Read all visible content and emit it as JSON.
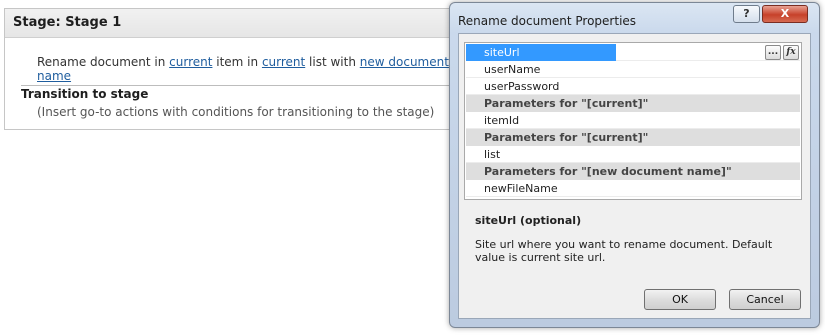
{
  "stage": {
    "title": "Stage: Stage 1",
    "action": {
      "prefix": "Rename document in ",
      "link1": "current",
      "mid1": " item in ",
      "link2": "current",
      "mid2": " list with ",
      "link3": "new document name"
    },
    "transition_title": "Transition to stage",
    "transition_hint": "(Insert go-to actions with conditions for transitioning to the stage)"
  },
  "dialog": {
    "title": "Rename document Properties",
    "help_label": "?",
    "close_label": "X",
    "ellipsis_label": "...",
    "fx_label": "fx",
    "rows": [
      {
        "label": "siteUrl",
        "kind": "param",
        "selected": true
      },
      {
        "label": "userName",
        "kind": "param"
      },
      {
        "label": "userPassword",
        "kind": "param"
      },
      {
        "label": "Parameters for \"[current]\"",
        "kind": "group"
      },
      {
        "label": "itemId",
        "kind": "param"
      },
      {
        "label": "Parameters for \"[current]\"",
        "kind": "group"
      },
      {
        "label": "list",
        "kind": "param"
      },
      {
        "label": "Parameters for \"[new document name]\"",
        "kind": "group"
      },
      {
        "label": "newFileName",
        "kind": "param"
      }
    ],
    "description_title": "siteUrl (optional)",
    "description_text": "Site url where you want to rename document. Default value is current site url.",
    "ok_label": "OK",
    "cancel_label": "Cancel"
  },
  "colors": {
    "selection": "#3399ff",
    "link": "#1f5d9e",
    "close_button": "#c7412a"
  }
}
